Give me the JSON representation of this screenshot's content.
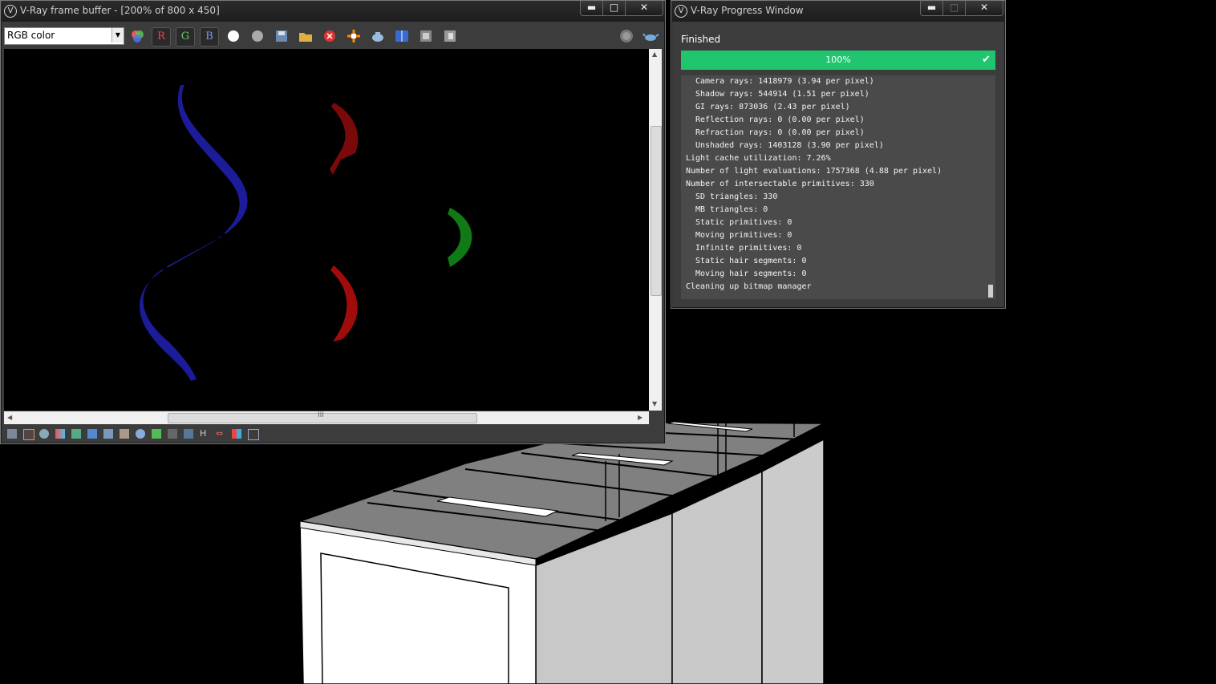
{
  "framebuffer": {
    "title": "V-Ray frame buffer - [200% of 800 x 450]",
    "channel_value": "RGB color",
    "buttons": {
      "r": "R",
      "g": "G",
      "b": "B"
    },
    "min_icon": "minimize-icon",
    "max_icon": "maximize-icon",
    "close_icon": "close-icon",
    "hscroll_grip": "III",
    "bottom_h_label": "H"
  },
  "progress": {
    "title": "V-Ray Progress Window",
    "status": "Finished",
    "percent_label": "100%",
    "fraction_complete": 1.0,
    "accent": "#21c56f",
    "log": [
      {
        "text": "Camera rays: 1418979 (3.94 per pixel)",
        "indent": true
      },
      {
        "text": "Shadow rays: 544914 (1.51 per pixel)",
        "indent": true
      },
      {
        "text": "GI rays: 873036 (2.43 per pixel)",
        "indent": true
      },
      {
        "text": "Reflection rays: 0 (0.00 per pixel)",
        "indent": true
      },
      {
        "text": "Refraction rays: 0 (0.00 per pixel)",
        "indent": true
      },
      {
        "text": "Unshaded rays: 1403128 (3.90 per pixel)",
        "indent": true
      },
      {
        "text": "Light cache utilization: 7.26%",
        "indent": false
      },
      {
        "text": "Number of light evaluations: 1757368 (4.88 per pixel)",
        "indent": false
      },
      {
        "text": "Number of intersectable primitives: 330",
        "indent": false
      },
      {
        "text": "SD triangles: 330",
        "indent": true
      },
      {
        "text": "MB triangles: 0",
        "indent": true
      },
      {
        "text": "Static primitives: 0",
        "indent": true
      },
      {
        "text": "Moving primitives: 0",
        "indent": true
      },
      {
        "text": "Infinite primitives: 0",
        "indent": true
      },
      {
        "text": "Static hair segments: 0",
        "indent": true
      },
      {
        "text": "Moving hair segments: 0",
        "indent": true
      },
      {
        "text": "Cleaning up bitmap manager",
        "indent": false
      }
    ]
  }
}
